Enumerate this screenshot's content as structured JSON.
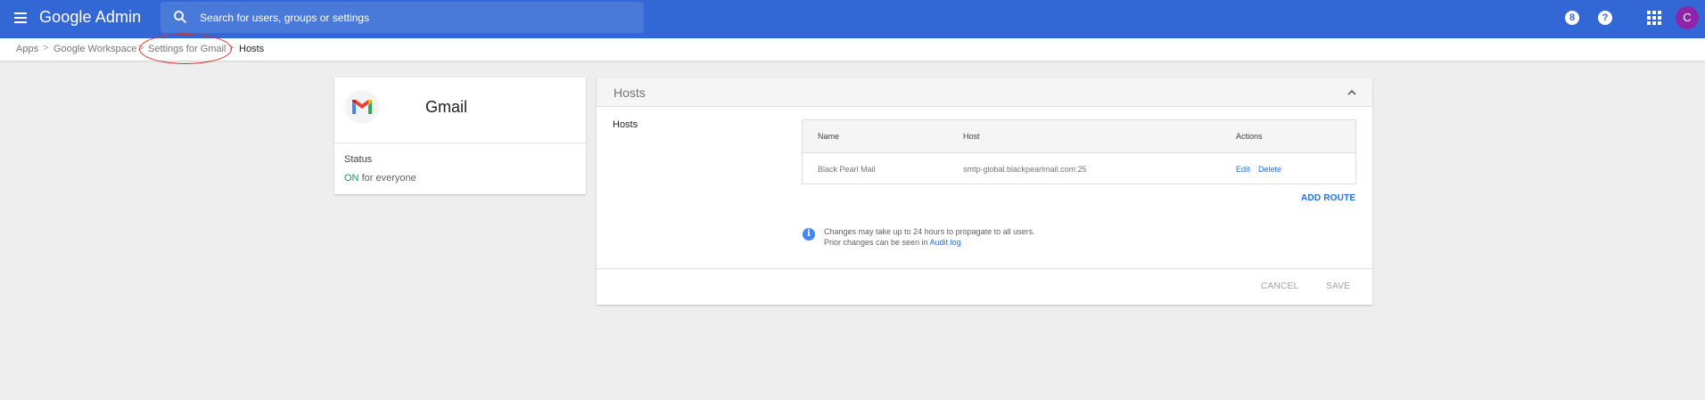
{
  "header": {
    "brand": "Google Admin",
    "search_placeholder": "Search for users, groups or settings",
    "account_initial": "C",
    "icons": [
      "menu-icon",
      "search-icon",
      "support-icon",
      "help-icon",
      "apps-grid-icon"
    ]
  },
  "breadcrumb": {
    "items": [
      {
        "label": "Apps"
      },
      {
        "label": "Google Workspace"
      },
      {
        "label": "Settings for Gmail"
      },
      {
        "label": "Hosts"
      }
    ],
    "separator": ">"
  },
  "app_card": {
    "name": "Gmail",
    "status_label": "Status",
    "status_on": "ON",
    "status_scope": "for everyone"
  },
  "hosts_panel": {
    "title": "Hosts",
    "section_label": "Hosts",
    "columns": [
      "Name",
      "Host",
      "Actions"
    ],
    "rows": [
      {
        "name": "Black Pearl Mail",
        "host": "smtp-global.blackpearlmail.com:25",
        "edit": "Edit",
        "sep": " · ",
        "delete": "Delete"
      }
    ],
    "add_route": "ADD ROUTE",
    "info_line1": "Changes may take up to 24 hours to propagate to all users.",
    "info_line2_prefix": "Prior changes can be seen in",
    "info_link": "Audit log",
    "cancel": "CANCEL",
    "save": "SAVE"
  },
  "colors": {
    "topbar": "#3367d6",
    "link": "#1a73e8",
    "status_on": "#0f9d58",
    "avatar": "#8e24aa",
    "annotation": "#d93025"
  }
}
